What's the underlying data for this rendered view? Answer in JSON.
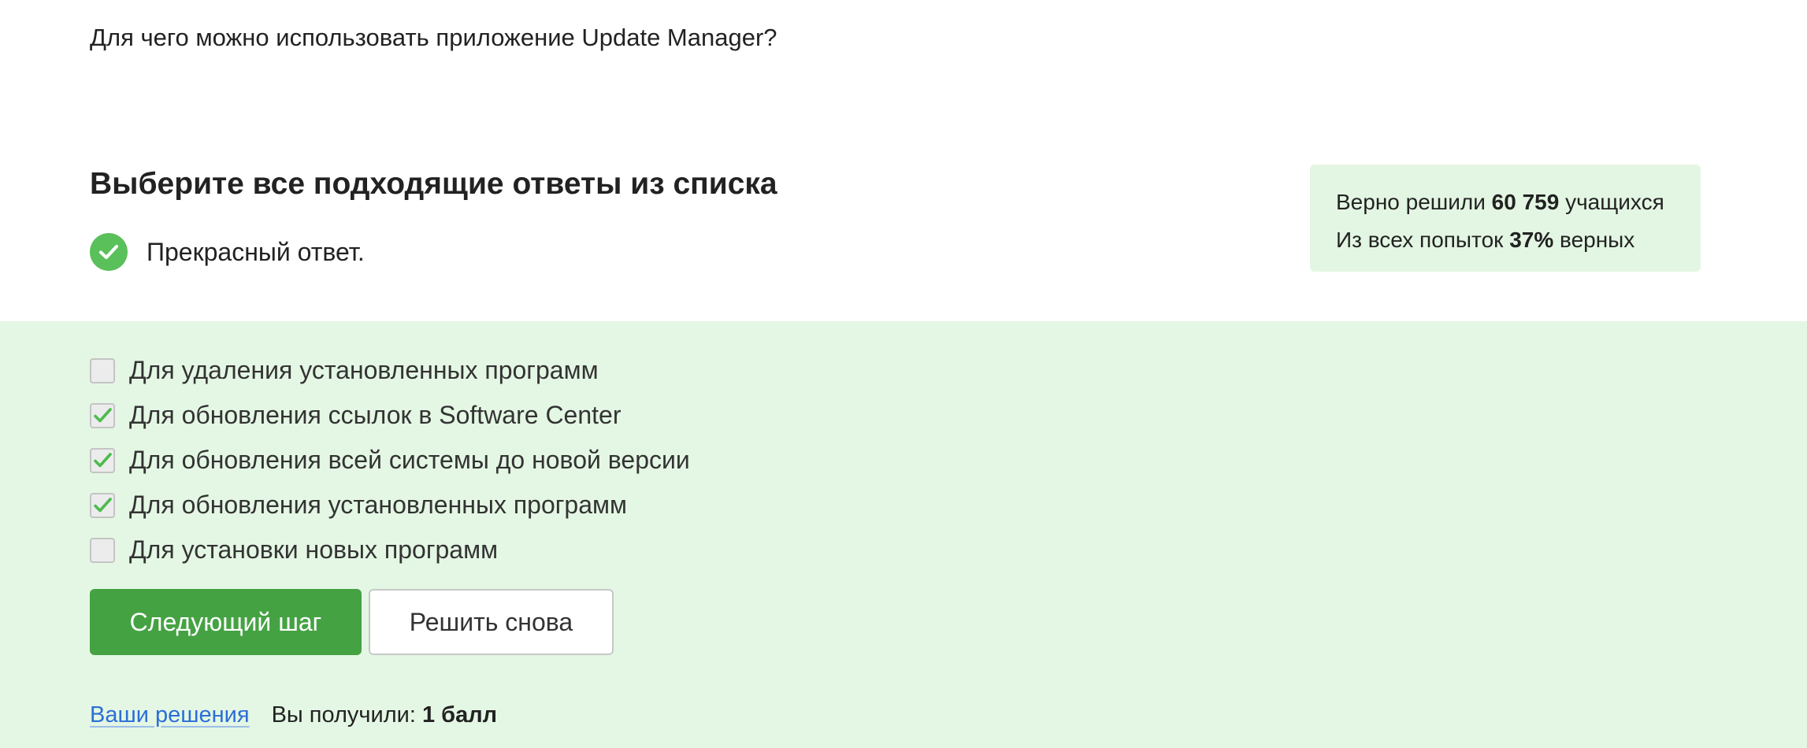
{
  "question": {
    "text": "Для чего можно использовать приложение Update Manager?"
  },
  "instruction": "Выберите все подходящие ответы из списка",
  "feedback": {
    "icon": "check-circle-icon",
    "text": "Прекрасный ответ."
  },
  "stats": {
    "solved_prefix": "Верно решили",
    "solved_count": "60 759",
    "solved_suffix": "учащихся",
    "attempts_prefix": "Из всех попыток",
    "attempts_percent": "37%",
    "attempts_suffix": "верных"
  },
  "options": [
    {
      "label": "Для удаления установленных программ",
      "checked": false
    },
    {
      "label": "Для обновления ссылок в Software Center",
      "checked": true
    },
    {
      "label": "Для обновления всей системы до новой версии",
      "checked": true
    },
    {
      "label": "Для обновления установленных программ",
      "checked": true
    },
    {
      "label": "Для установки новых программ",
      "checked": false
    }
  ],
  "buttons": {
    "next": "Следующий шаг",
    "retry": "Решить снова"
  },
  "footer": {
    "solutions_link": "Ваши решения",
    "score_prefix": "Вы получили:",
    "score_value": "1 балл"
  },
  "colors": {
    "accent": "#45a243",
    "panel_bg": "#e4f7e4",
    "stats_bg": "#e3f6e3",
    "check": "#5ac05a",
    "link": "#2b6fd6"
  }
}
